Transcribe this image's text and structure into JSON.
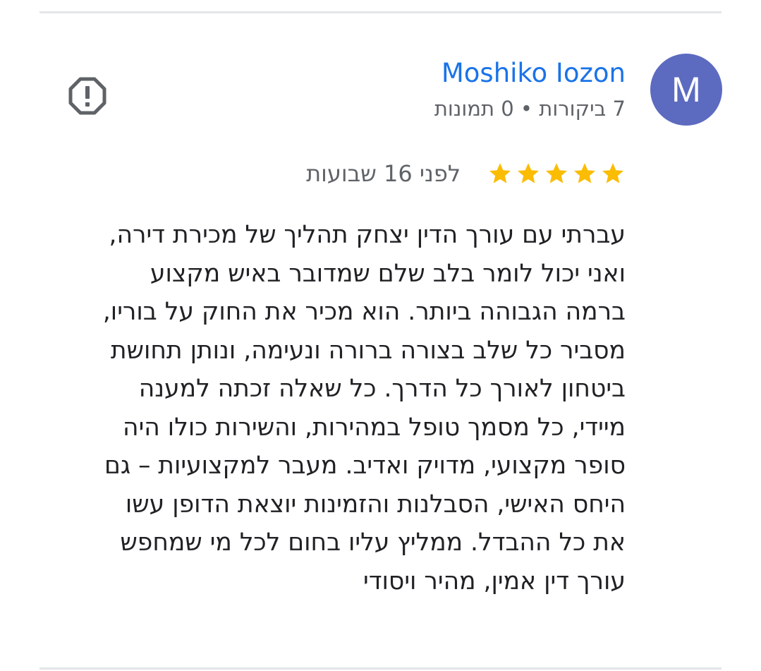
{
  "reviewer": {
    "avatar_letter": "M",
    "avatar_color": "#5c6bc0",
    "name": "Moshiko Iozon",
    "name_color": "#1a73e8",
    "meta": "7 ביקורות • 0 תמונות"
  },
  "report_icon": "report-flag-octagon-icon",
  "review": {
    "rating": 5,
    "star_color": "#fbbc04",
    "date": "לפני 16 שבועות",
    "text_lines": [
      "עברתי עם עורך הדין יצחק תהליך של מכירת דירה,",
      "ואני יכול לומר בלב שלם שמדובר באיש מקצוע",
      "ברמה הגבוהה ביותר. הוא מכיר את החוק על בוריו,",
      "מסביר כל שלב בצורה ברורה ונעימה, ונותן תחושת",
      "ביטחון לאורך כל הדרך. כל שאלה זכתה למענה",
      "מיידי, כל מסמך טופל במהירות, והשירות כולו היה",
      "סופר מקצועי, מדויק ואדיב. מעבר למקצועיות – גם",
      "היחס האישי, הסבלנות והזמינות יוצאת הדופן עשו",
      "את כל ההבדל. ממליץ עליו בחום לכל מי שמחפש",
      "עורך דין אמין, מהיר ויסודי"
    ]
  }
}
